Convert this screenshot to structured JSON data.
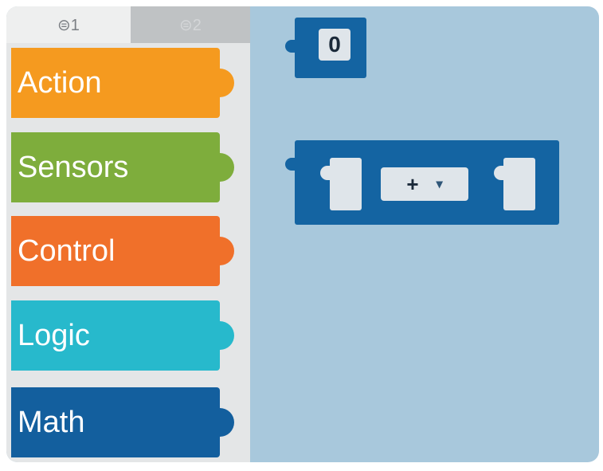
{
  "tabs": [
    {
      "label": "⊜1"
    },
    {
      "label": "⊜2"
    }
  ],
  "categories": [
    {
      "label": "Action",
      "color": "#f59a1f"
    },
    {
      "label": "Sensors",
      "color": "#7ead3c"
    },
    {
      "label": "Control",
      "color": "#f0702a"
    },
    {
      "label": "Logic",
      "color": "#27b9cc"
    },
    {
      "label": "Math",
      "color": "#135f9e"
    }
  ],
  "canvas": {
    "background": "#a8c8dc",
    "number_block": {
      "value": "0",
      "color": "#1464a2"
    },
    "arithmetic_block": {
      "operator": "+",
      "dropdown_icon": "chevron-down-icon",
      "color": "#1464a2"
    }
  }
}
